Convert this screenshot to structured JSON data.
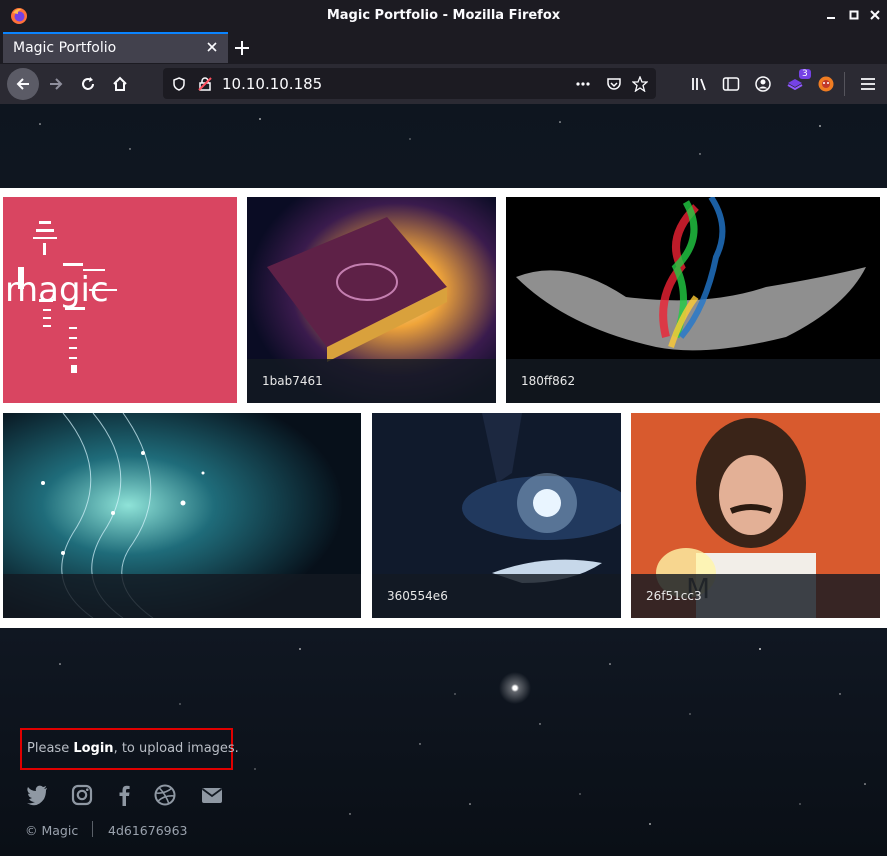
{
  "window": {
    "title": "Magic Portfolio - Mozilla Firefox"
  },
  "tab": {
    "label": "Magic Portfolio"
  },
  "url": "10.10.10.185",
  "extension_badge": "3",
  "gallery": {
    "logo_text": "magic",
    "captions": [
      "1bab7461",
      "180ff862",
      "360554e6",
      "26f51cc3"
    ]
  },
  "login": {
    "prefix": "Please ",
    "link": "Login",
    "suffix": ", to upload images."
  },
  "social": [
    "twitter-icon",
    "instagram-icon",
    "facebook-icon",
    "dribbble-icon",
    "email-icon"
  ],
  "footer": {
    "copyright": "© Magic",
    "hash": "4d61676963"
  },
  "colors": {
    "accent": "#0a84ff",
    "highlight_box": "#e00000",
    "logo_tile": "#d94561"
  }
}
